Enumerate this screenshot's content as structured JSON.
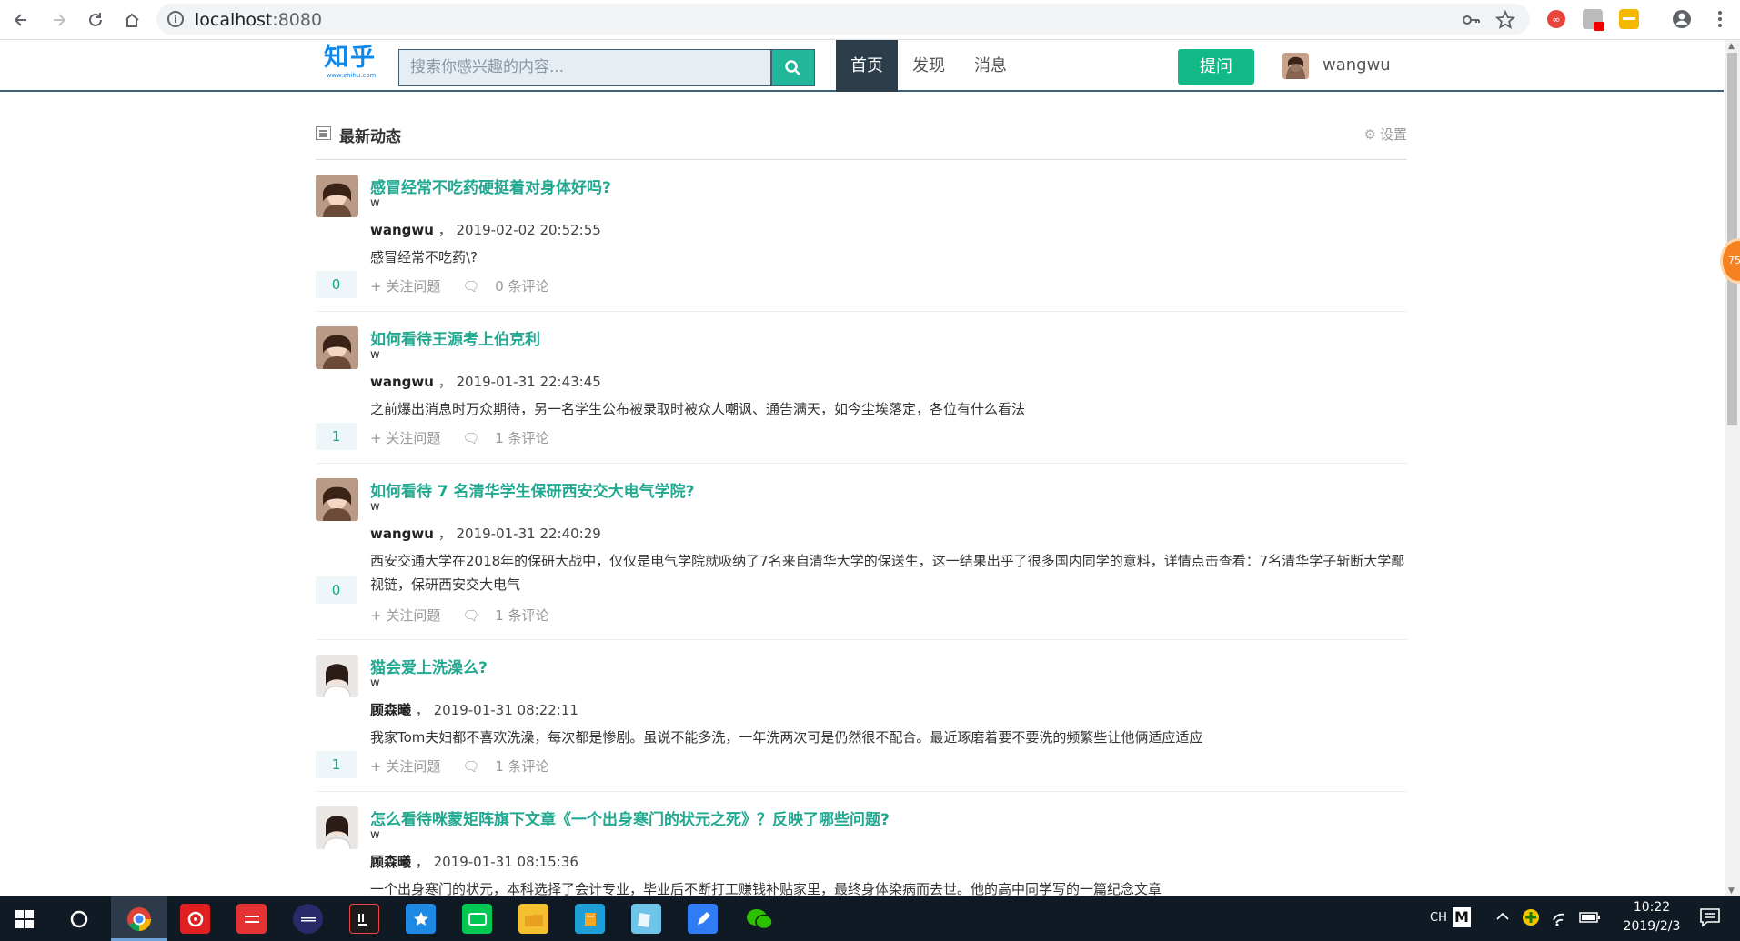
{
  "browser": {
    "url_host": "localhost",
    "url_port": ":8080"
  },
  "header": {
    "logo_main": "知乎",
    "logo_sub": "www.zhihu.com",
    "search_placeholder": "搜索你感兴趣的内容...",
    "nav": [
      "首页",
      "发现",
      "消息"
    ],
    "ask_label": "提问",
    "username": "wangwu"
  },
  "feed": {
    "title": "最新动态",
    "settings_label": "设置",
    "follow_label": "关注问题",
    "items": [
      {
        "title": "感冒经常不吃药硬挺着对身体好吗?",
        "tag": "w",
        "author": "wangwu",
        "sep": " ，",
        "time": "2019-02-02 20:52:55",
        "body": "感冒经常不吃药\\?",
        "votes": "0",
        "comments": "0 条评论"
      },
      {
        "title": "如何看待王源考上伯克利",
        "tag": "w",
        "author": "wangwu",
        "sep": " ，",
        "time": "2019-01-31 22:43:45",
        "body": "之前爆出消息时万众期待，另一名学生公布被录取时被众人嘲讽、通告满天，如今尘埃落定，各位有什么看法",
        "votes": "1",
        "comments": "1 条评论"
      },
      {
        "title": "如何看待 7 名清华学生保研西安交大电气学院?",
        "tag": "w",
        "author": "wangwu",
        "sep": " ，",
        "time": "2019-01-31 22:40:29",
        "body": "西安交通大学在2018年的保研大战中，仅仅是电气学院就吸纳了7名来自清华大学的保送生，这一结果出乎了很多国内同学的意料，详情点击查看：7名清华学子斩断大学鄙视链，保研西安交大电气",
        "votes": "0",
        "comments": "1 条评论"
      },
      {
        "title": "猫会爱上洗澡么?",
        "tag": "w",
        "author": "顾森曦",
        "sep": " ，",
        "time": "2019-01-31 08:22:11",
        "body": "我家Tom夫妇都不喜欢洗澡，每次都是惨剧。虽说不能多洗，一年洗两次可是仍然很不配合。最近琢磨着要不要洗的频繁些让他俩适应适应",
        "votes": "1",
        "comments": "1 条评论"
      },
      {
        "title": "怎么看待咪蒙矩阵旗下文章《一个出身寒门的状元之死》？反映了哪些问题?",
        "tag": "w",
        "author": "顾森曦",
        "sep": " ，",
        "time": "2019-01-31 08:15:36",
        "body": "一个出身寒门的状元，本科选择了会计专业，毕业后不断打工赚钱补贴家里，最终身体染病而去世。他的高中同学写的一篇纪念文章",
        "votes": "",
        "comments": ""
      }
    ]
  },
  "float_badge": "75",
  "taskbar": {
    "lang": "CH",
    "ime": "M",
    "time": "10:22",
    "date": "2019/2/3"
  },
  "colors": {
    "accent": "#12b886",
    "link": "#21a890",
    "nav_active": "#2b3e4a",
    "logo": "#0f88eb"
  }
}
